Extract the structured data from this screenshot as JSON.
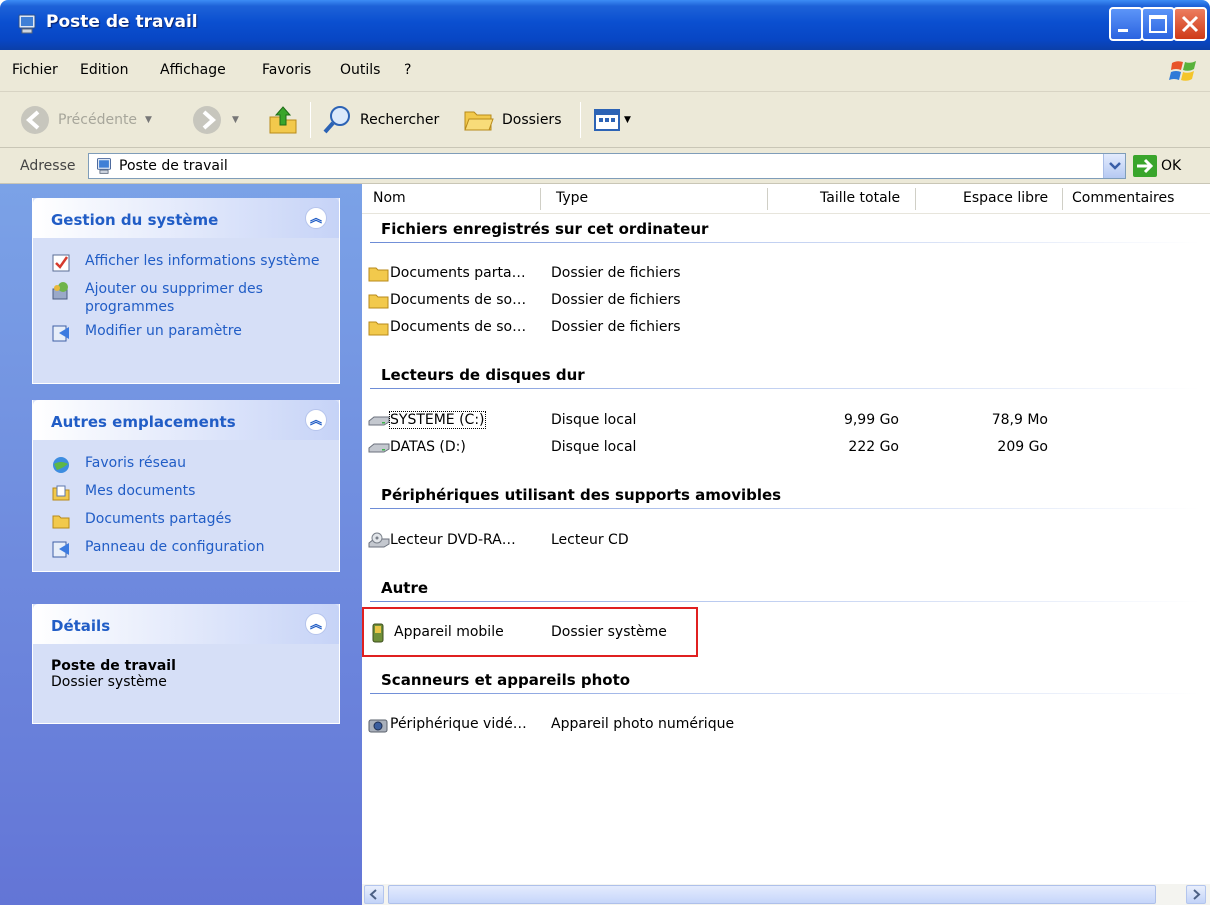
{
  "window": {
    "title": "Poste de travail",
    "colors": {
      "titlebar": "#0a4fd0",
      "taskpane": "#6375d6",
      "panel_title": "#215dc6",
      "highlight": "#e02020"
    }
  },
  "menu": {
    "items": [
      "Fichier",
      "Edition",
      "Affichage",
      "Favoris",
      "Outils",
      "?"
    ]
  },
  "toolbar": {
    "back_label": "Précédente",
    "search_label": "Rechercher",
    "folders_label": "Dossiers"
  },
  "address": {
    "label": "Adresse",
    "value": "Poste de travail",
    "go_label": "OK"
  },
  "taskpane": {
    "system": {
      "title": "Gestion du système",
      "items": [
        "Afficher les informations système",
        "Ajouter ou supprimer des programmes",
        "Modifier un paramètre"
      ]
    },
    "places": {
      "title": "Autres emplacements",
      "items": [
        "Favoris réseau",
        "Mes documents",
        "Documents partagés",
        "Panneau de configuration"
      ]
    },
    "details": {
      "title": "Détails",
      "name": "Poste de travail",
      "type": "Dossier système"
    }
  },
  "columns": [
    "Nom",
    "Type",
    "Taille totale",
    "Espace libre",
    "Commentaires"
  ],
  "groups": [
    {
      "title": "Fichiers enregistrés sur cet ordinateur",
      "rows": [
        {
          "icon": "folder-icon",
          "name": "Documents parta…",
          "type": "Dossier de fichiers",
          "total": "",
          "free": ""
        },
        {
          "icon": "folder-icon",
          "name": "Documents de so…",
          "type": "Dossier de fichiers",
          "total": "",
          "free": ""
        },
        {
          "icon": "folder-icon",
          "name": "Documents de so…",
          "type": "Dossier de fichiers",
          "total": "",
          "free": ""
        }
      ]
    },
    {
      "title": "Lecteurs de disques dur",
      "rows": [
        {
          "icon": "hard-drive-icon",
          "name": "SYSTEME (C:)",
          "type": "Disque local",
          "total": "9,99 Go",
          "free": "78,9 Mo"
        },
        {
          "icon": "hard-drive-icon",
          "name": "DATAS (D:)",
          "type": "Disque local",
          "total": "222 Go",
          "free": "209 Go"
        }
      ]
    },
    {
      "title": "Périphériques utilisant des supports amovibles",
      "rows": [
        {
          "icon": "dvd-drive-icon",
          "name": "Lecteur DVD-RA…",
          "type": "Lecteur CD",
          "total": "",
          "free": ""
        }
      ]
    },
    {
      "title": "Autre",
      "rows": [
        {
          "icon": "mobile-device-icon",
          "name": "Appareil mobile",
          "type": "Dossier système",
          "total": "",
          "free": ""
        }
      ]
    },
    {
      "title": "Scanneurs et appareils photo",
      "rows": [
        {
          "icon": "camera-icon",
          "name": "Périphérique vidé…",
          "type": "Appareil photo numérique",
          "total": "",
          "free": ""
        }
      ]
    }
  ]
}
